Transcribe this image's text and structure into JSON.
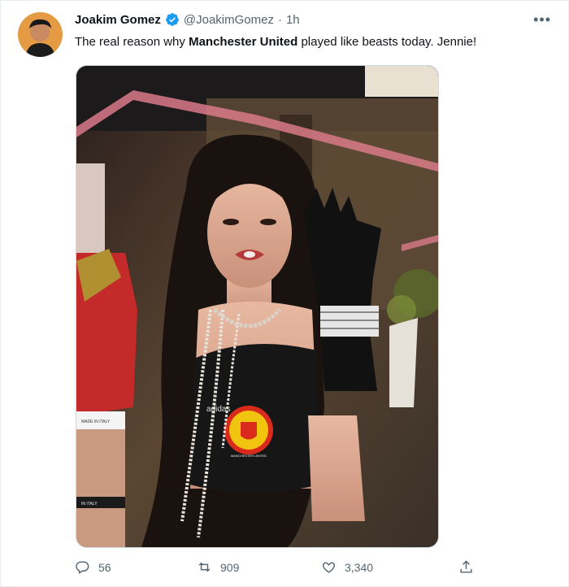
{
  "tweet": {
    "author_name": "Joakim Gomez",
    "handle": "@JoakimGomez",
    "separator": "·",
    "time": "1h",
    "text_before": "The real reason why ",
    "text_bold": "Manchester United",
    "text_after": " played like beasts today. Jennie!",
    "more_label": "•••"
  },
  "media": {
    "shirt_text": "adidas",
    "badge_text": "MANCHESTER UNITED",
    "waistband_text": "MADE IN ITALY",
    "waistband_text2": "IN ITALY"
  },
  "actions": {
    "reply_count": "56",
    "retweet_count": "909",
    "like_count": "3,340"
  },
  "colors": {
    "verified": "#1d9bf0",
    "text": "#0f1419",
    "muted": "#536471"
  }
}
